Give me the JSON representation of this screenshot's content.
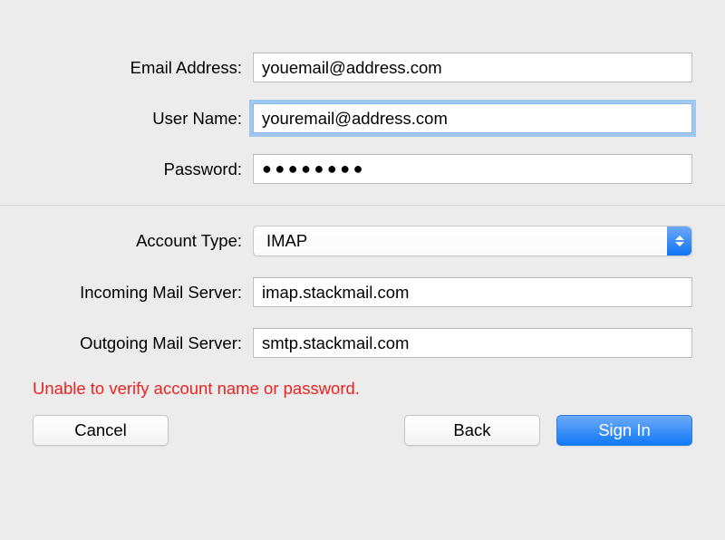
{
  "form": {
    "email_label": "Email Address:",
    "email_value": "youemail@address.com",
    "username_label": "User Name:",
    "username_value": "youremail@address.com",
    "password_label": "Password:",
    "password_dots": "●●●●●●●●",
    "account_type_label": "Account Type:",
    "account_type_value": "IMAP",
    "incoming_label": "Incoming Mail Server:",
    "incoming_value": "imap.stackmail.com",
    "outgoing_label": "Outgoing Mail Server:",
    "outgoing_value": "smtp.stackmail.com"
  },
  "error": "Unable to verify account name or password.",
  "buttons": {
    "cancel": "Cancel",
    "back": "Back",
    "signin": "Sign In"
  }
}
